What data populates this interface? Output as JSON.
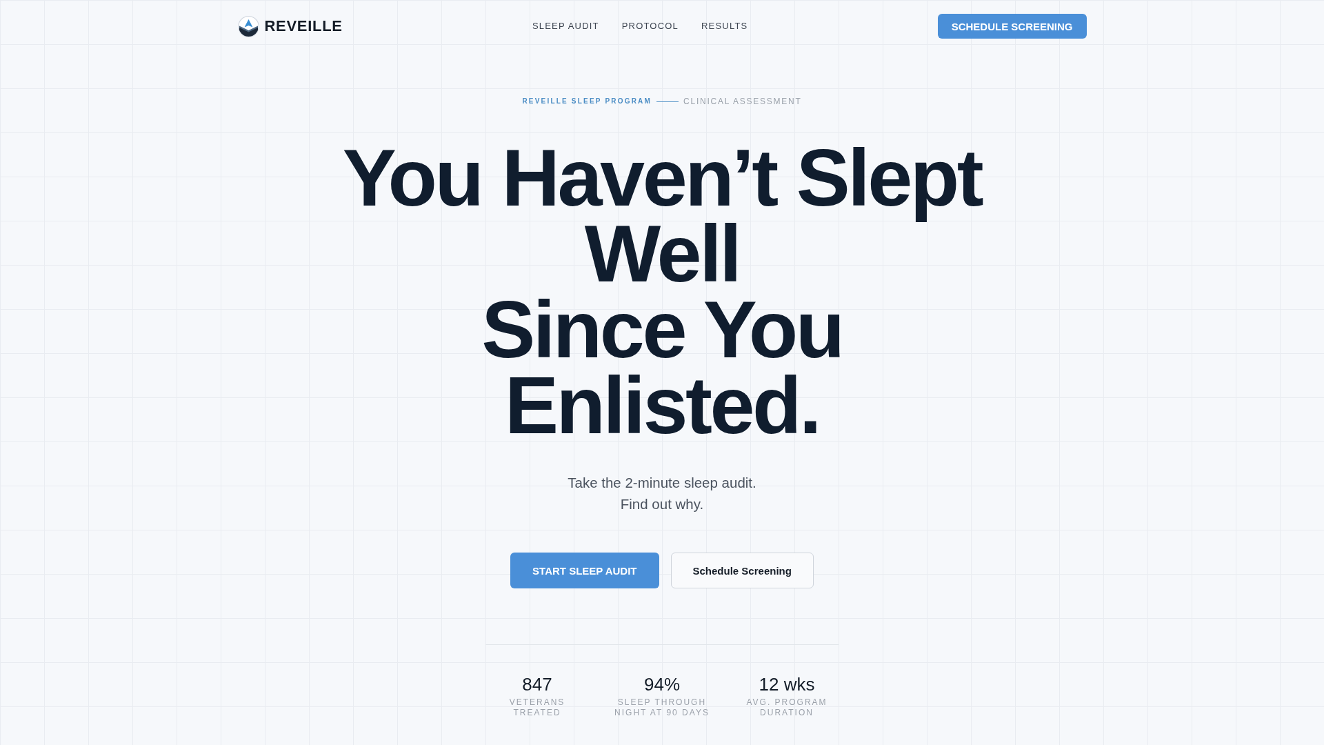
{
  "nav": {
    "logo": "REVEILLE",
    "links": [
      "SLEEP AUDIT",
      "PROTOCOL",
      "RESULTS"
    ],
    "cta": "SCHEDULE SCREENING"
  },
  "hero": {
    "eyebrow": "REVEILLE SLEEP PROGRAM",
    "eyebrow_secondary": "CLINICAL ASSESSMENT",
    "headline": [
      "You Haven’t Slept Well",
      "Since You Enlisted."
    ],
    "subtitle": "Take the 2-minute sleep audit. Find out why.",
    "buttons": [
      {
        "label": "START SLEEP AUDIT",
        "kind": "primary"
      },
      {
        "label": "Schedule Screening",
        "kind": "secondary"
      }
    ]
  },
  "stats": [
    {
      "value": "847",
      "label": "VETERANS TREATED"
    },
    {
      "value": "94%",
      "label": "SLEEP THROUGH NIGHT AT 90 DAYS"
    },
    {
      "value": "12 wks",
      "label": "AVG. PROGRAM DURATION"
    }
  ]
}
